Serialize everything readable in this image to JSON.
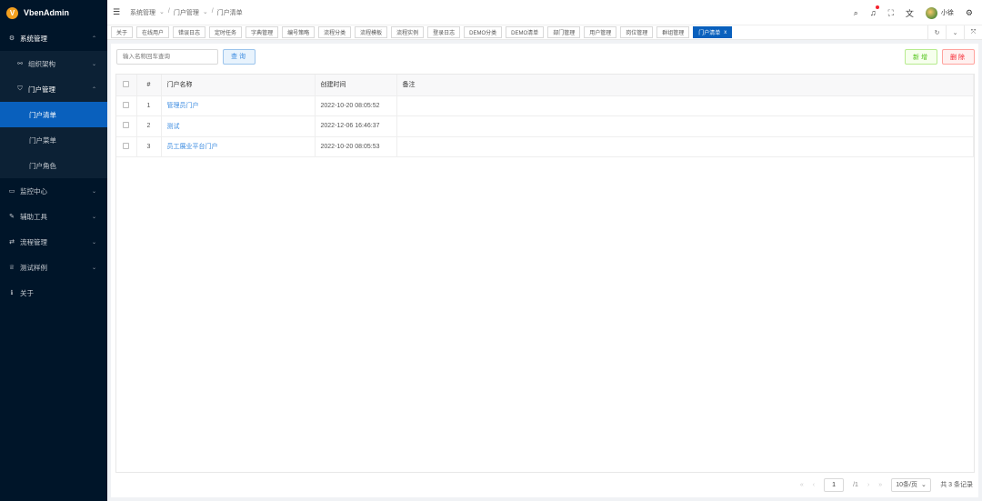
{
  "app": {
    "logo_letter": "V",
    "name": "VbenAdmin"
  },
  "sidebar": {
    "items": [
      {
        "icon": "gear-icon",
        "glyph": "⚙",
        "label": "系统管理",
        "arrow": "⌃"
      },
      {
        "icon": "org-icon",
        "glyph": "⚯",
        "label": "组织架构",
        "arrow": "⌄"
      },
      {
        "icon": "shield-icon",
        "glyph": "⛉",
        "label": "门户管理",
        "arrow": "⌃"
      },
      {
        "label": "门户清单"
      },
      {
        "label": "门户菜单"
      },
      {
        "label": "门户角色"
      },
      {
        "icon": "monitor-icon",
        "glyph": "▭",
        "label": "监控中心",
        "arrow": "⌄"
      },
      {
        "icon": "tool-icon",
        "glyph": "✎",
        "label": "辅助工具",
        "arrow": "⌄"
      },
      {
        "icon": "flow-icon",
        "glyph": "⇄",
        "label": "流程管理",
        "arrow": "⌄"
      },
      {
        "icon": "trophy-icon",
        "glyph": "♕",
        "label": "测试样例",
        "arrow": "⌄"
      },
      {
        "icon": "about-icon",
        "glyph": "ℹ",
        "label": "关于"
      }
    ]
  },
  "header": {
    "breadcrumb": [
      "系统管理",
      "门户管理",
      "门户清单"
    ],
    "user_name": "小徐"
  },
  "tabs": [
    "关于",
    "在线用户",
    "错误日志",
    "定时任务",
    "字典管理",
    "编号策略",
    "流程分类",
    "流程模板",
    "流程实例",
    "登录日志",
    "DEMO分类",
    "DEMO清单",
    "部门管理",
    "用户管理",
    "岗位管理",
    "群组管理",
    "门户清单"
  ],
  "toolbar": {
    "search_placeholder": "输入名称回车查询",
    "query_label": "查询",
    "add_label": "新增",
    "delete_label": "删除"
  },
  "table": {
    "columns": [
      "#",
      "门户名称",
      "创建时间",
      "备注"
    ],
    "rows": [
      {
        "index": "1",
        "name": "管理员门户",
        "created": "2022-10-20 08:05:52",
        "note": ""
      },
      {
        "index": "2",
        "name": "测试",
        "created": "2022-12-06 16:46:37",
        "note": ""
      },
      {
        "index": "3",
        "name": "员工展业平台门户",
        "created": "2022-10-20 08:05:53",
        "note": ""
      }
    ]
  },
  "pager": {
    "current": "1",
    "total_pages": "/1",
    "page_size": "10条/页",
    "total_text": "共 3 条记录"
  },
  "colors": {
    "sidebar_bg": "#001529",
    "accent": "#0960bd",
    "link": "#3b8be0",
    "add": "#52c41a",
    "delete": "#f5222d"
  }
}
